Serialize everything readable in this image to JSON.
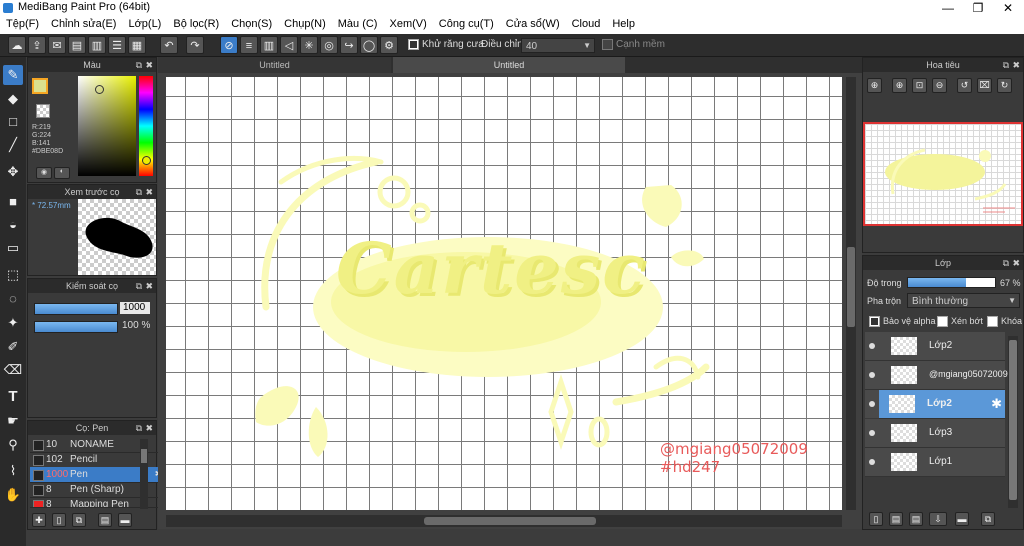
{
  "app": {
    "title": "MediBang Paint Pro (64bit)",
    "win_min": "—",
    "win_max": "❐",
    "win_close": "✕"
  },
  "menu": [
    "Tệp(F)",
    "Chỉnh sửa(E)",
    "Lớp(L)",
    "Bộ lọc(R)",
    "Chọn(S)",
    "Chụp(N)",
    "Màu (C)",
    "Xem(V)",
    "Công cụ(T)",
    "Cửa sổ(W)",
    "Cloud",
    "Help"
  ],
  "toolbar": {
    "antialias_label": "Khử răng cưa",
    "adjust_label": "Điều chỉnh",
    "adjust_value": "40",
    "smooth_label": "Cạnh mềm"
  },
  "color_panel": {
    "title": "Màu",
    "r": "R:219",
    "g": "G:224",
    "b": "B:141",
    "hex": "#DBE08D",
    "primary": "#dbe08d"
  },
  "brush_preview": {
    "title": "Xem trước cọ",
    "size": "72.57mm"
  },
  "brush_control": {
    "title": "Kiểm soát cọ",
    "size_value": "1000",
    "opacity_value": "100 %"
  },
  "brush_list": {
    "title": "Cọ: Pen",
    "items": [
      {
        "size": "10",
        "name": "NONAME"
      },
      {
        "size": "102",
        "name": "Pencil"
      },
      {
        "size": "1000",
        "name": "Pen"
      },
      {
        "size": "8",
        "name": "Pen (Sharp)"
      },
      {
        "size": "8",
        "name": "Mapping Pen"
      }
    ]
  },
  "tabs": [
    "Untitled",
    "Untitled"
  ],
  "canvas": {
    "lettering": "Cartesc",
    "sig1": "@mgiang05072009",
    "sig2": "#hd247"
  },
  "navigator": {
    "title": "Hoa tiêu"
  },
  "layers": {
    "title": "Lớp",
    "opacity_label": "Độ trong",
    "opacity_value": "67 %",
    "opacity_fraction": 0.67,
    "blend_label": "Pha trộn",
    "blend_value": "Bình thường",
    "protect_alpha": "Bảo vệ alpha",
    "clipping": "Xén bớt",
    "lock": "Khóa",
    "items": [
      {
        "name": "Lớp2"
      },
      {
        "name": "@mgiang05072009"
      },
      {
        "name": "Lớp2"
      },
      {
        "name": "Lớp3"
      },
      {
        "name": "Lớp1"
      }
    ]
  }
}
